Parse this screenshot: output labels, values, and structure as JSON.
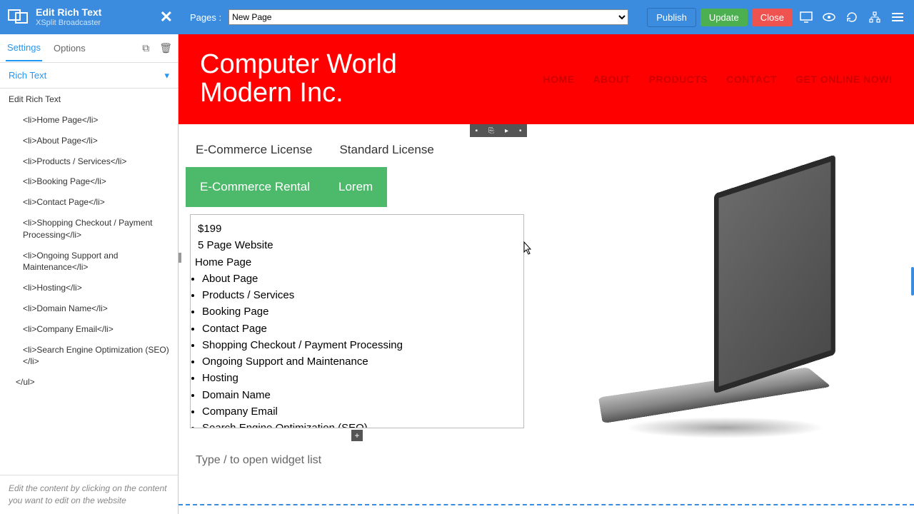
{
  "topbar": {
    "panel_title": "Edit Rich Text",
    "panel_sub": "XSplit Broadcaster",
    "pages_label": "Pages :",
    "page_selected": "New Page",
    "publish": "Publish",
    "update": "Update",
    "close": "Close"
  },
  "sidebar": {
    "tabs": {
      "settings": "Settings",
      "options": "Options"
    },
    "rich_text": "Rich Text",
    "edit_label": "Edit Rich Text",
    "lines": [
      "<li>Home Page</li>",
      "<li>About Page</li>",
      "<li>Products / Services</li>",
      "<li>Booking Page</li>",
      "<li>Contact Page</li>",
      "<li>Shopping Checkout / Payment Processing</li>",
      "<li>Ongoing Support and Maintenance</li>",
      "<li>Hosting</li>",
      "<li>Domain Name</li>",
      "<li>Company Email</li>",
      "<li>Search Engine Optimization (SEO)</li>",
      "</ul>"
    ],
    "help": "Edit the content by clicking on the content you want to edit on the website"
  },
  "site": {
    "title_line1": "Computer World",
    "title_line2": "Modern Inc.",
    "nav": [
      "HOME",
      "ABOUT",
      "PRODUCTS",
      "CONTACT",
      "GET ONLINE NOW!"
    ]
  },
  "content": {
    "tab1": "E-Commerce License",
    "tab2": "Standard License",
    "tab3": "E-Commerce Rental",
    "tab4": "Lorem",
    "price": "$199",
    "line2": "5 Page Website",
    "items": [
      "Home Page",
      "About Page",
      "Products / Services",
      "Booking Page",
      "Contact Page",
      "Shopping Checkout / Payment Processing",
      "Ongoing Support and Maintenance",
      "Hosting",
      "Domain Name",
      "Company Email",
      "Search Engine Optimization (SEO)"
    ],
    "widget_hint": "Type / to open widget list"
  }
}
